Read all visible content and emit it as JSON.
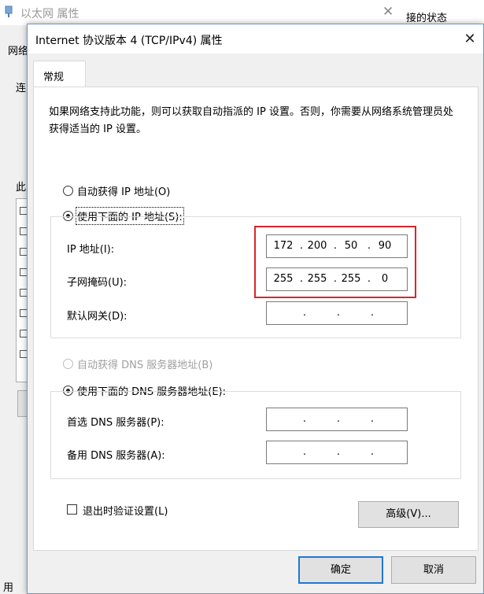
{
  "background_window": {
    "title": "以太网 属性",
    "status_tab": "接的状态",
    "fragments": [
      "网络",
      "连",
      "此",
      "用"
    ]
  },
  "dialog": {
    "title": "Internet 协议版本 4 (TCP/IPv4) 属性",
    "tab_general": "常规",
    "description": "如果网络支持此功能，则可以获取自动指派的 IP 设置。否则，你需要从网络系统管理员处获得适当的 IP 设置。",
    "ip_auto_label": "自动获得 IP 地址(O)",
    "ip_manual_label": "使用下面的 IP 地址(S):",
    "ip_address_label": "IP 地址(I):",
    "subnet_mask_label": "子网掩码(U):",
    "gateway_label": "默认网关(D):",
    "ip_address": [
      "172",
      "200",
      "50",
      "90"
    ],
    "subnet_mask": [
      "255",
      "255",
      "255",
      "0"
    ],
    "gateway": [
      "",
      "",
      "",
      ""
    ],
    "dns_auto_label": "自动获得 DNS 服务器地址(B)",
    "dns_manual_label": "使用下面的 DNS 服务器地址(E):",
    "preferred_dns_label": "首选 DNS 服务器(P):",
    "alternate_dns_label": "备用 DNS 服务器(A):",
    "preferred_dns": [
      "",
      "",
      "",
      ""
    ],
    "alternate_dns": [
      "",
      "",
      "",
      ""
    ],
    "validate_label": "退出时验证设置(L)",
    "advanced_button": "高级(V)...",
    "ok_button": "确定",
    "cancel_button": "取消"
  },
  "colors": {
    "highlight_border": "#d9262b",
    "default_button_border": "#1f78d6"
  }
}
